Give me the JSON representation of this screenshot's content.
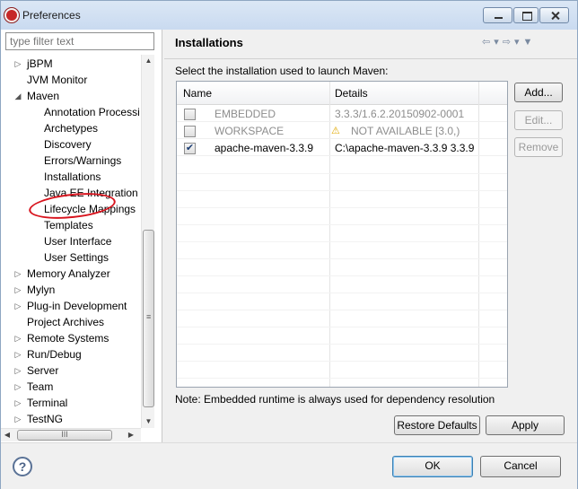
{
  "window": {
    "title": "Preferences",
    "icon": "eclipse-icon"
  },
  "filter": {
    "placeholder": "type filter text"
  },
  "tree": [
    {
      "label": "jBPM",
      "arrow": "▷"
    },
    {
      "label": "JVM Monitor",
      "arrow": ""
    },
    {
      "label": "Maven",
      "arrow": "◢"
    },
    {
      "label": "Annotation Processi",
      "arrow": ""
    },
    {
      "label": "Archetypes",
      "arrow": ""
    },
    {
      "label": "Discovery",
      "arrow": ""
    },
    {
      "label": "Errors/Warnings",
      "arrow": ""
    },
    {
      "label": "Installations",
      "arrow": ""
    },
    {
      "label": "Java EE Integration",
      "arrow": ""
    },
    {
      "label": "Lifecycle Mappings",
      "arrow": ""
    },
    {
      "label": "Templates",
      "arrow": ""
    },
    {
      "label": "User Interface",
      "arrow": ""
    },
    {
      "label": "User Settings",
      "arrow": ""
    },
    {
      "label": "Memory Analyzer",
      "arrow": "▷"
    },
    {
      "label": "Mylyn",
      "arrow": "▷"
    },
    {
      "label": "Plug-in Development",
      "arrow": "▷"
    },
    {
      "label": "Project Archives",
      "arrow": ""
    },
    {
      "label": "Remote Systems",
      "arrow": "▷"
    },
    {
      "label": "Run/Debug",
      "arrow": "▷"
    },
    {
      "label": "Server",
      "arrow": "▷"
    },
    {
      "label": "Team",
      "arrow": "▷"
    },
    {
      "label": "Terminal",
      "arrow": "▷"
    },
    {
      "label": "TestNG",
      "arrow": "▷"
    }
  ],
  "scroll": {
    "up": "▲",
    "down": "▼",
    "left": "◀",
    "right": "▶",
    "grip_v": "≡",
    "grip_h": "III"
  },
  "page": {
    "title": "Installations",
    "nav": {
      "back": "⇦",
      "back_menu": "▾",
      "forward": "⇨",
      "forward_menu": "▾",
      "menu": "▼"
    },
    "description": "Select the installation used to launch Maven:",
    "columns": [
      "Name",
      "Details"
    ],
    "rows": [
      {
        "checked": false,
        "name": "EMBEDDED",
        "details": "3.3.3/1.6.2.20150902-0001",
        "disabled": true,
        "warning": false
      },
      {
        "checked": false,
        "name": "WORKSPACE",
        "details": "NOT AVAILABLE [3.0,)",
        "disabled": true,
        "warning": true
      },
      {
        "checked": true,
        "name": "apache-maven-3.3.9",
        "details": "C:\\apache-maven-3.3.9 3.3.9",
        "disabled": false,
        "warning": false
      }
    ],
    "check_mark": "✔",
    "warn_icon": "⚠",
    "side_buttons": {
      "add": "Add...",
      "edit": "Edit...",
      "remove": "Remove"
    },
    "note": "Note: Embedded runtime is always used for dependency resolution",
    "restore_defaults": "Restore Defaults",
    "apply": "Apply"
  },
  "footer": {
    "help": "?",
    "ok": "OK",
    "cancel": "Cancel"
  }
}
